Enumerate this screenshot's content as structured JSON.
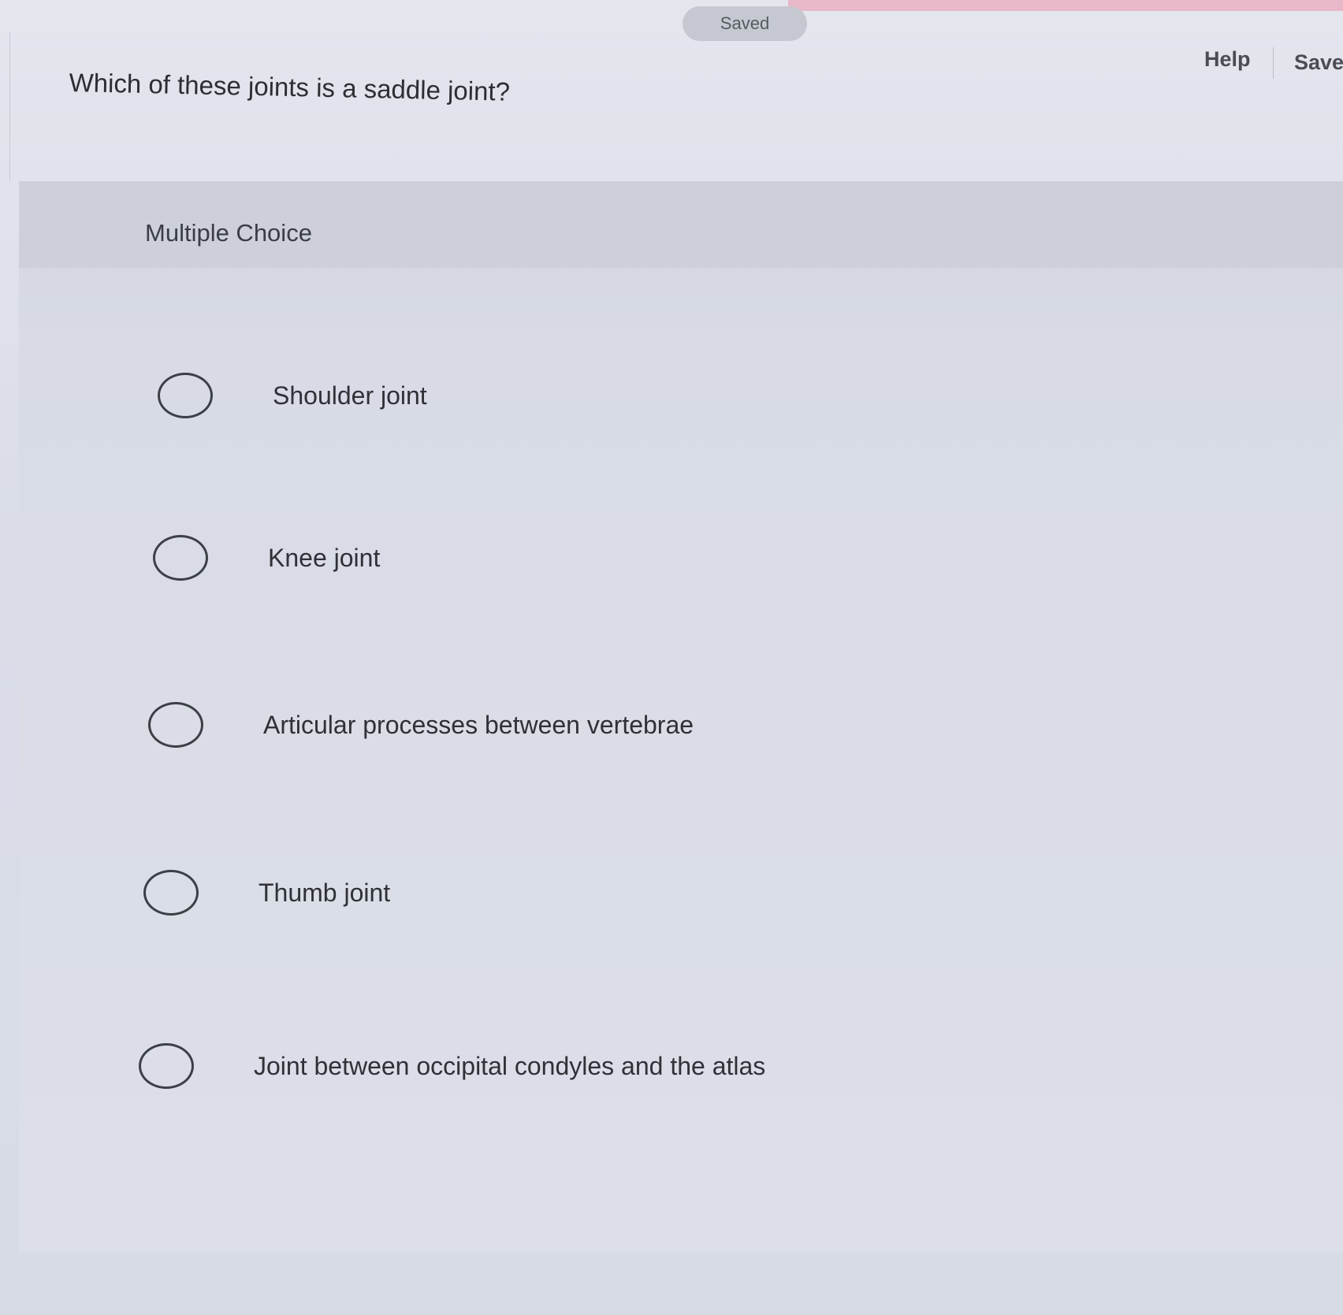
{
  "header": {
    "saved_label": "Saved",
    "help_label": "Help",
    "save_label": "Save"
  },
  "question": {
    "text": "Which of these joints is a saddle joint?"
  },
  "card": {
    "type_label": "Multiple Choice",
    "options": [
      {
        "label": "Shoulder joint",
        "selected": false
      },
      {
        "label": "Knee joint",
        "selected": false
      },
      {
        "label": "Articular processes between vertebrae",
        "selected": false
      },
      {
        "label": "Thumb joint",
        "selected": false
      },
      {
        "label": "Joint between occipital condyles and the atlas",
        "selected": false
      }
    ]
  }
}
